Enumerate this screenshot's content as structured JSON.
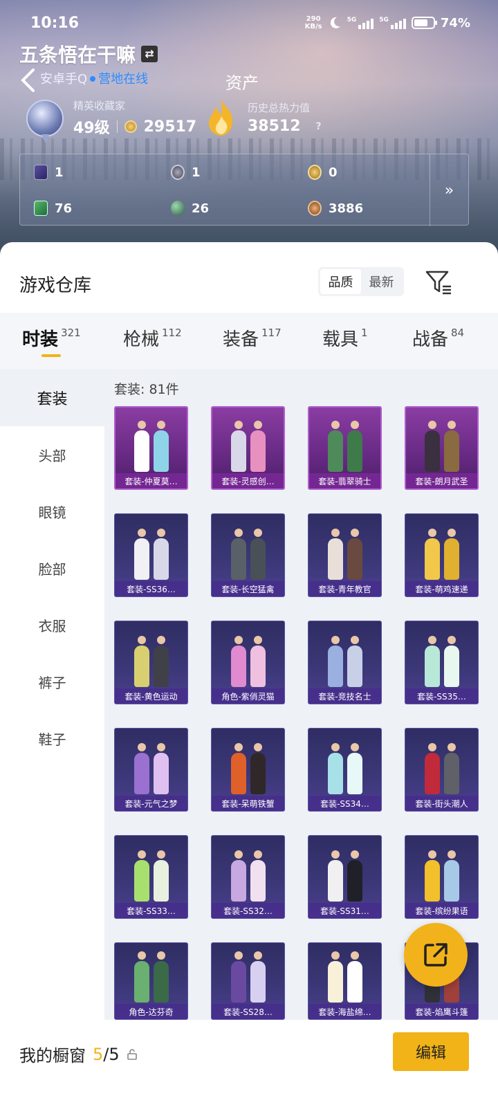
{
  "status": {
    "time": "10:16",
    "net_speed": "290",
    "net_unit": "KB/s",
    "sig1": "5G",
    "sig2": "5G",
    "battery": "74%",
    "battery_level": 0.74
  },
  "profile": {
    "username": "五条悟在干嘛",
    "platform": "安卓手Q",
    "online_status": "营地在线",
    "assets_title": "资产",
    "rank_label": "精英收藏家",
    "rank_level": "49级",
    "coins": "29517",
    "heat_label": "历史总热力值",
    "heat_value": "38512",
    "help": "?"
  },
  "resources": [
    {
      "icon": "card-icon",
      "value": "1"
    },
    {
      "icon": "silver-coin-icon",
      "value": "1"
    },
    {
      "icon": "gold-coin-icon",
      "value": "0"
    },
    {
      "icon": "green-card-icon",
      "value": "76"
    },
    {
      "icon": "orb-icon",
      "value": "26"
    },
    {
      "icon": "bronze-coin-icon",
      "value": "3886"
    }
  ],
  "resources_more": "»",
  "warehouse": {
    "title": "游戏仓库",
    "sort_options": [
      "品质",
      "最新"
    ],
    "active_sort": "品质"
  },
  "tabs": [
    {
      "label": "时装",
      "count": "321"
    },
    {
      "label": "枪械",
      "count": "112"
    },
    {
      "label": "装备",
      "count": "117"
    },
    {
      "label": "载具",
      "count": "1"
    },
    {
      "label": "战备",
      "count": "84"
    }
  ],
  "side_items": [
    "套装",
    "头部",
    "眼镜",
    "脸部",
    "衣服",
    "裤子",
    "鞋子"
  ],
  "grid_count": "套装: 81件",
  "items": [
    {
      "label": "套装-仲夏莫…",
      "rarity": "purple",
      "c1": "#ffffff",
      "c2": "#8fd3e8"
    },
    {
      "label": "套装-灵感创…",
      "rarity": "purple",
      "c1": "#d8d8e8",
      "c2": "#e890c0"
    },
    {
      "label": "套装-翡翠骑士",
      "rarity": "purple",
      "c1": "#4f8a5a",
      "c2": "#3f7a4a"
    },
    {
      "label": "套装-朗月武圣",
      "rarity": "purple",
      "c1": "#3a3040",
      "c2": "#8a6a40"
    },
    {
      "label": "套装-SS36…",
      "rarity": "blue",
      "c1": "#f0f0f5",
      "c2": "#d8d8e8"
    },
    {
      "label": "套装-长空猛禽",
      "rarity": "blue",
      "c1": "#5a6068",
      "c2": "#4a5058"
    },
    {
      "label": "套装-青年教官",
      "rarity": "blue",
      "c1": "#e8e0d8",
      "c2": "#6a4a40"
    },
    {
      "label": "套装-萌鸡速递",
      "rarity": "blue",
      "c1": "#f2c84a",
      "c2": "#e0b030"
    },
    {
      "label": "套装-黄色运动",
      "rarity": "blue",
      "c1": "#d8d070",
      "c2": "#404048"
    },
    {
      "label": "角色-紫俏灵猫",
      "rarity": "blue",
      "c1": "#e08ad0",
      "c2": "#f0c0e0"
    },
    {
      "label": "套装-竞技名士",
      "rarity": "blue",
      "c1": "#9ab0e0",
      "c2": "#c8d0e8"
    },
    {
      "label": "套装-SS35…",
      "rarity": "blue",
      "c1": "#b8e8d8",
      "c2": "#e8f8f0"
    },
    {
      "label": "套装-元气之梦",
      "rarity": "blue",
      "c1": "#9a70d0",
      "c2": "#e0c0f0"
    },
    {
      "label": "套装-呆萌铁蟹",
      "rarity": "blue",
      "c1": "#e0602a",
      "c2": "#302828"
    },
    {
      "label": "套装-SS34…",
      "rarity": "blue",
      "c1": "#a8e0e8",
      "c2": "#e8f8f8"
    },
    {
      "label": "套装-街头潮人",
      "rarity": "blue",
      "c1": "#c02a3a",
      "c2": "#606068"
    },
    {
      "label": "套装-SS33…",
      "rarity": "blue",
      "c1": "#a8e070",
      "c2": "#e8f0e0"
    },
    {
      "label": "套装-SS32…",
      "rarity": "blue",
      "c1": "#c8a8e0",
      "c2": "#f0e0f0"
    },
    {
      "label": "套装-SS31…",
      "rarity": "blue",
      "c1": "#f0f0f0",
      "c2": "#202028"
    },
    {
      "label": "套装-缤纷果语",
      "rarity": "blue",
      "c1": "#f2c02a",
      "c2": "#a8c8e8"
    },
    {
      "label": "角色-达芬奇",
      "rarity": "blue",
      "c1": "#6ab070",
      "c2": "#3a6a48"
    },
    {
      "label": "套装-SS28…",
      "rarity": "blue",
      "c1": "#6a4aa0",
      "c2": "#d8d0f0"
    },
    {
      "label": "套装-海盐绵…",
      "rarity": "blue",
      "c1": "#f8f0d8",
      "c2": "#ffffff"
    },
    {
      "label": "套装-焰鹰斗篷",
      "rarity": "blue",
      "c1": "#303038",
      "c2": "#a0403a"
    }
  ],
  "bottom": {
    "window_label": "我的橱窗",
    "count": "5",
    "total": "/5",
    "edit": "编辑"
  }
}
